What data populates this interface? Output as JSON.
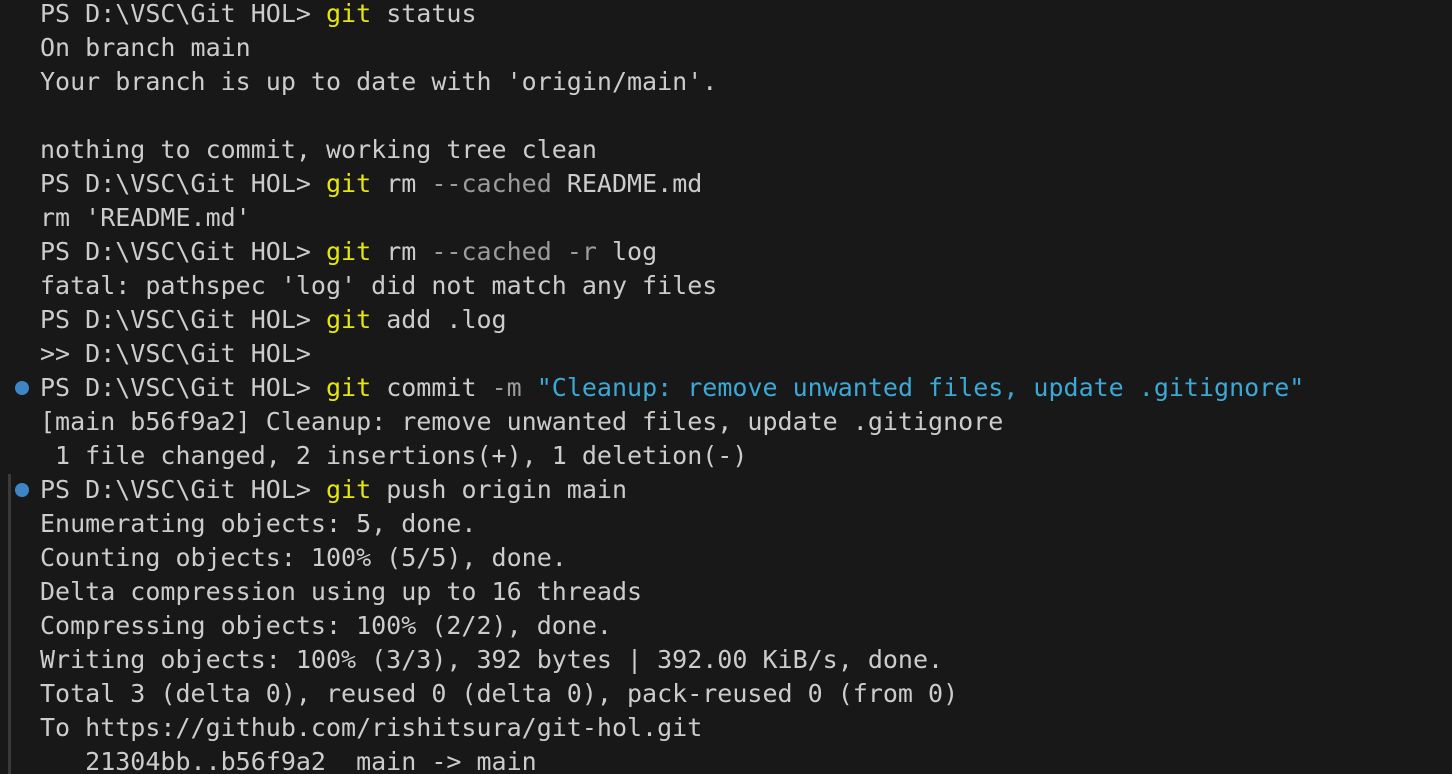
{
  "terminal": {
    "l1": {
      "prompt": "PS D:\\VSC\\Git HOL> ",
      "cmd": "git",
      "rest": " status"
    },
    "l2": "On branch main",
    "l3": "Your branch is up to date with 'origin/main'.",
    "l4": "",
    "l5": "nothing to commit, working tree clean",
    "l6": {
      "prompt": "PS D:\\VSC\\Git HOL> ",
      "cmd": "git",
      "a": " rm ",
      "flag": "--cached",
      "b": " README.md"
    },
    "l7": "rm 'README.md'",
    "l8": {
      "prompt": "PS D:\\VSC\\Git HOL> ",
      "cmd": "git",
      "a": " rm ",
      "flag": "--cached -r",
      "b": " log"
    },
    "l9": "fatal: pathspec 'log' did not match any files",
    "l10": {
      "prompt": "PS D:\\VSC\\Git HOL> ",
      "cmd": "git",
      "rest": " add .log"
    },
    "l11": ">> D:\\VSC\\Git HOL>",
    "l12": {
      "prompt": "PS D:\\VSC\\Git HOL> ",
      "cmd": "git",
      "a": " commit ",
      "flag": "-m",
      "str": " \"Cleanup: remove unwanted files, update .gitignore\""
    },
    "l13": "[main b56f9a2] Cleanup: remove unwanted files, update .gitignore",
    "l14": " 1 file changed, 2 insertions(+), 1 deletion(-)",
    "l15": {
      "prompt": "PS D:\\VSC\\Git HOL> ",
      "cmd": "git",
      "rest": " push origin main"
    },
    "l16": "Enumerating objects: 5, done.",
    "l17": "Counting objects: 100% (5/5), done.",
    "l18": "Delta compression using up to 16 threads",
    "l19": "Compressing objects: 100% (2/2), done.",
    "l20": "Writing objects: 100% (3/3), 392 bytes | 392.00 KiB/s, done.",
    "l21": "Total 3 (delta 0), reused 0 (delta 0), pack-reused 0 (from 0)",
    "l22": "To https://github.com/rishitsura/git-hol.git",
    "l23": "   21304bb..b56f9a2  main -> main"
  },
  "colors": {
    "background": "#181818",
    "text": "#cccccc",
    "command": "#e5e510",
    "flag": "#9c9c9c",
    "string": "#3ba8d6",
    "decoration": "#3d86c6"
  },
  "icons": {
    "command_decoration": "command-decoration-dot-icon"
  }
}
